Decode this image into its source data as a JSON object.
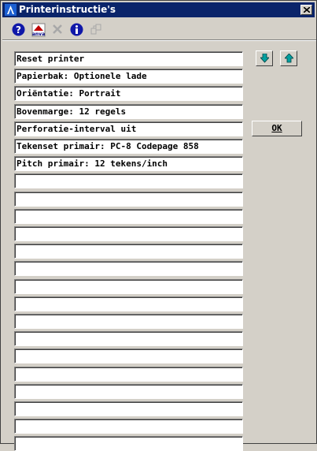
{
  "window": {
    "title": "Printerinstructie's",
    "colors": {
      "titlebar": "#0a246a",
      "face": "#d4d0c8"
    }
  },
  "toolbar": {
    "buttons": [
      {
        "icon": "help-icon",
        "label": "?"
      },
      {
        "icon": "anva-icon",
        "label": "anva"
      },
      {
        "icon": "delete-icon",
        "label": ""
      },
      {
        "icon": "info-icon",
        "label": "i"
      },
      {
        "icon": "copy-icon",
        "label": ""
      }
    ]
  },
  "instructions": {
    "items": [
      "Reset printer",
      "Papierbak: Optionele lade",
      "Oriëntatie: Portrait",
      "Bovenmarge: 12 regels",
      "Perforatie-interval uit",
      "Tekenset primair: PC-8 Codepage 858",
      "Pitch primair: 12 tekens/inch",
      "",
      "",
      "",
      "",
      "",
      "",
      "",
      "",
      "",
      "",
      "",
      "",
      "",
      "",
      "",
      ""
    ]
  },
  "buttons": {
    "ok_label": "OK",
    "move_down": "down-arrow-icon",
    "move_up": "up-arrow-icon"
  }
}
